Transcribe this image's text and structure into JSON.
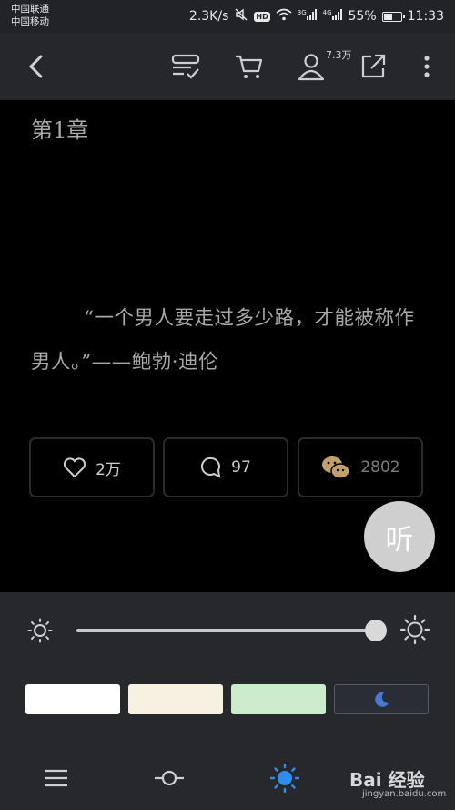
{
  "status_bar": {
    "carrier_1": "中国联通",
    "carrier_2": "中国移动",
    "speed": "2.3K/s",
    "hd": "HD",
    "net_3g": "3G",
    "net_4g": "4G",
    "battery": "55%",
    "battery_level": 0.55,
    "time": "11:33"
  },
  "toolbar": {
    "user_count": "7.3万"
  },
  "content": {
    "chapter_title": "第1章",
    "quote": "“一个男人要走过多少路，才能被称作男人。”——鲍勃·迪伦"
  },
  "stats": {
    "likes": "2万",
    "comments": "97",
    "shares": "2802"
  },
  "listen_label": "听",
  "brightness": {
    "level": 0.95
  },
  "themes": {
    "colors": [
      "#ffffff",
      "#f7f1e1",
      "#caeccd",
      "#2a2d35"
    ],
    "night_accent": "#4a78d6"
  },
  "watermark": {
    "logo": "Bai 经验",
    "url": "jingyan.baidu.com"
  },
  "colors": {
    "accent_blue": "#2c8ef0",
    "wechat_gold": "#c2a06a"
  }
}
